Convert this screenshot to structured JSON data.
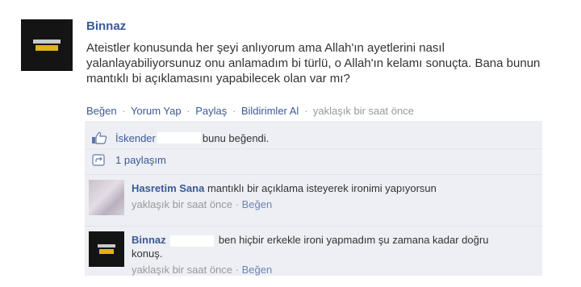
{
  "post": {
    "author": "Binnaz",
    "text": "Ateistler konusunda her şeyi anlıyorum ama Allah'ın ayetlerini nasıl yalanlayabiliyorsunuz onu anlamadım bi türlü, o Allah'ın kelamı sonuçta. Bana bunun mantıklı bi açıklamasını yapabilecek olan var mı?",
    "actions": {
      "like": "Beğen",
      "comment": "Yorum Yap",
      "share": "Paylaş",
      "notifications": "Bildirimler Al",
      "separator": "·",
      "time": "yaklaşık bir saat önce"
    }
  },
  "likes": {
    "name": "İskender",
    "suffix": "bunu beğendi."
  },
  "shares": {
    "label": "1 paylaşım"
  },
  "comments": [
    {
      "author": "Hasretim Sana",
      "text": "mantıklı bir açıklama isteyerek ironimi yapıyorsun",
      "time": "yaklaşık bir saat önce",
      "separator": "·",
      "like": "Beğen"
    },
    {
      "author": "Binnaz",
      "text": "ben hiçbir erkekle ironi yapmadım şu zamana kadar doğru konuş.",
      "time": "yaklaşık bir saat önce",
      "separator": "·",
      "like": "Beğen"
    }
  ],
  "colors": {
    "link": "#3b5998",
    "feedback_bg": "#edeff4",
    "muted": "#999999"
  }
}
